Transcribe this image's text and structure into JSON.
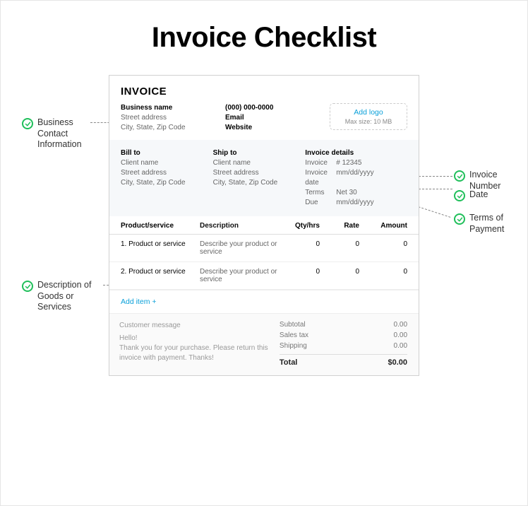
{
  "title": "Invoice Checklist",
  "callouts": {
    "businessContact": "Business\nContact\nInformation",
    "descriptionGoods": "Description of\nGoods or\nServices",
    "invoiceNumber": "Invoice Number",
    "date": "Date",
    "termsPayment": "Terms of\nPayment"
  },
  "invoice": {
    "heading": "INVOICE",
    "business": {
      "nameLabel": "Business name",
      "street": "Street address",
      "cityState": "City, State, Zip Code",
      "phone": "(000) 000-0000",
      "email": "Email",
      "website": "Website"
    },
    "logoBox": {
      "addLabel": "Add logo",
      "maxSize": "Max size: 10 MB"
    },
    "billTo": {
      "title": "Bill to",
      "name": "Client name",
      "street": "Street address",
      "cityState": "City, State, Zip Code"
    },
    "shipTo": {
      "title": "Ship to",
      "name": "Client name",
      "street": "Street address",
      "cityState": "City, State, Zip Code"
    },
    "details": {
      "title": "Invoice details",
      "invoiceLabel": "Invoice",
      "invoiceNum": "# 12345",
      "invoiceDateLabel": "Invoice date",
      "invoiceDate": "mm/dd/yyyy",
      "termsLabel": "Terms",
      "terms": "Net 30",
      "dueLabel": "Due",
      "due": "mm/dd/yyyy"
    },
    "table": {
      "headers": {
        "product": "Product/service",
        "description": "Description",
        "qty": "Qty/hrs",
        "rate": "Rate",
        "amount": "Amount"
      },
      "rows": [
        {
          "num": "1.",
          "product": "Product or service",
          "desc": "Describe your product or service",
          "qty": "0",
          "rate": "0",
          "amount": "0"
        },
        {
          "num": "2.",
          "product": "Product or service",
          "desc": "Describe your product or service",
          "qty": "0",
          "rate": "0",
          "amount": "0"
        }
      ],
      "addItem": "Add item +"
    },
    "message": {
      "title": "Customer message",
      "body": "Hello!\nThank you for your purchase. Please return this invoice with payment. Thanks!"
    },
    "totals": {
      "subtotalLabel": "Subtotal",
      "subtotal": "0.00",
      "taxLabel": "Sales tax",
      "tax": "0.00",
      "shippingLabel": "Shipping",
      "shipping": "0.00",
      "totalLabel": "Total",
      "total": "$0.00"
    }
  }
}
